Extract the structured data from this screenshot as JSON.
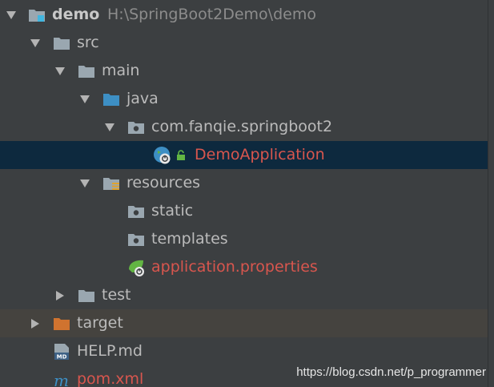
{
  "tree": {
    "root": {
      "name": "demo",
      "path": "H:\\SpringBoot2Demo\\demo",
      "icon": "module-folder-icon"
    },
    "src": {
      "name": "src",
      "icon": "folder-icon"
    },
    "main": {
      "name": "main",
      "icon": "folder-icon"
    },
    "java": {
      "name": "java",
      "icon": "source-root-folder-icon"
    },
    "package": {
      "name": "com.fanqie.springboot2",
      "icon": "package-icon"
    },
    "app_class": {
      "name": "DemoApplication",
      "icon": "spring-boot-class-icon",
      "status_color": "#d8564e"
    },
    "resources": {
      "name": "resources",
      "icon": "resources-folder-icon"
    },
    "static": {
      "name": "static",
      "icon": "package-icon"
    },
    "templates": {
      "name": "templates",
      "icon": "package-icon"
    },
    "props": {
      "name": "application.properties",
      "icon": "spring-properties-icon",
      "status_color": "#d8564e"
    },
    "test": {
      "name": "test",
      "icon": "folder-icon"
    },
    "target": {
      "name": "target",
      "icon": "excluded-folder-icon"
    },
    "help": {
      "name": "HELP.md",
      "icon": "markdown-file-icon"
    },
    "pom": {
      "name": "pom.xml",
      "icon": "maven-file-icon",
      "status_color": "#d8564e"
    }
  },
  "watermark": "https://blog.csdn.net/p_programmer"
}
